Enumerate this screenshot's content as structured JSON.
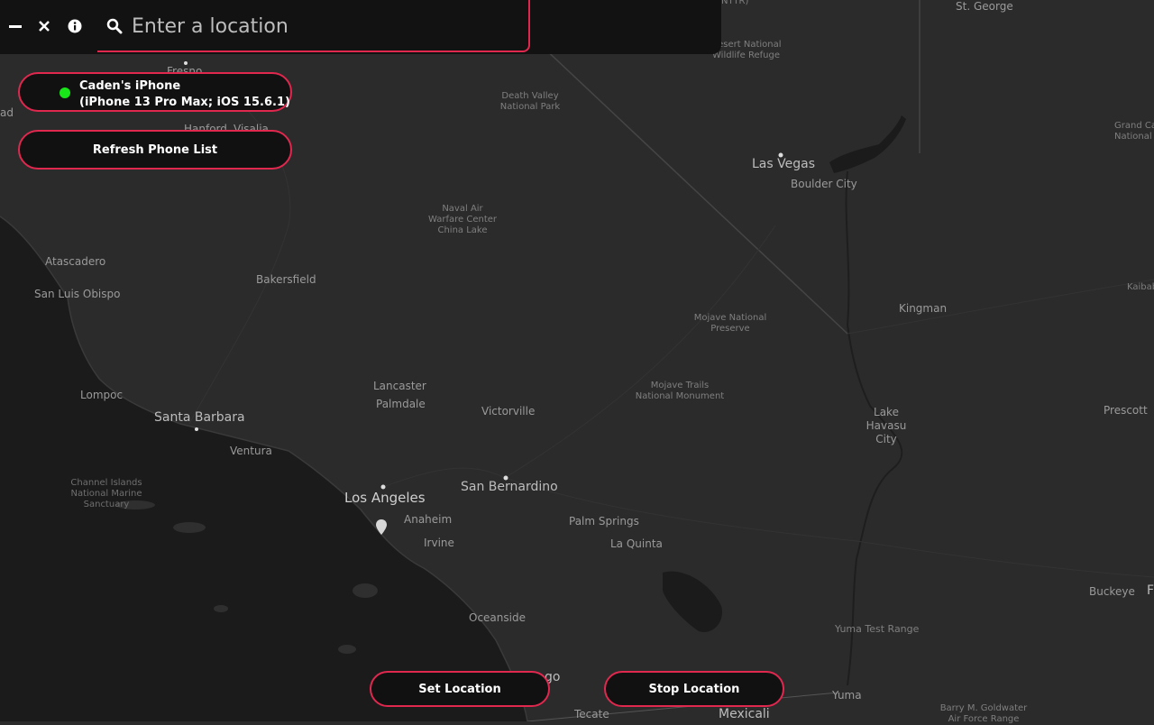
{
  "window_controls": {
    "minimize_icon": "minimize-icon",
    "close_icon": "close-icon",
    "info_icon": "info-icon"
  },
  "search": {
    "icon": "search-icon",
    "placeholder": "Enter a location",
    "value": ""
  },
  "device": {
    "name_line1": "Caden's iPhone",
    "name_line2": "(iPhone 13 Pro Max; iOS 15.6.1)",
    "status_color": "#19e619"
  },
  "buttons": {
    "refresh": "Refresh Phone List",
    "set_location": "Set Location",
    "stop_location": "Stop Location"
  },
  "theme": {
    "accent": "#e0284f",
    "panel": "#121212",
    "land": "#2b2b2b",
    "water": "#1b1b1b"
  },
  "map": {
    "places": {
      "st_george": "St. George",
      "nttr": "NTTR)",
      "desert_refuge": "Desert National Wildlife Refuge",
      "fresno": "Fresno",
      "hanford": "Hanford",
      "visalia": "Visalia",
      "death_valley": "Death Valley National Park",
      "grand_canyon": "Grand Ca National",
      "las_vegas": "Las Vegas",
      "boulder_city": "Boulder City",
      "naval_air": "Naval Air Warfare Center China Lake",
      "atascadero": "Atascadero",
      "san_luis_obispo": "San Luis Obispo",
      "bakersfield": "Bakersfield",
      "kaibab": "Kaibab",
      "kingman": "Kingman",
      "mojave_preserve": "Mojave National Preserve",
      "mojave_trails": "Mojave Trails National Monument",
      "lancaster": "Lancaster",
      "palmdale": "Palmdale",
      "victorville": "Victorville",
      "lompoc": "Lompoc",
      "santa_barbara": "Santa Barbara",
      "ventura": "Ventura",
      "lake_havasu": "Lake Havasu City",
      "prescott": "Prescott",
      "channel_islands": "Channel Islands National Marine Sanctuary",
      "los_angeles": "Los Angeles",
      "san_bernardino": "San Bernardino",
      "anaheim": "Anaheim",
      "irvine": "Irvine",
      "palm_springs": "Palm Springs",
      "la_quinta": "La Quinta",
      "buckeye": "Buckeye",
      "oceanside": "Oceanside",
      "yuma_test": "Yuma Test Range",
      "yuma": "Yuma",
      "tecate": "Tecate",
      "mexicali": "Mexicali",
      "barry": "Barry M. Goldwater Air Force Range",
      "ad": "ad",
      "go": "go",
      "f": "F"
    }
  }
}
